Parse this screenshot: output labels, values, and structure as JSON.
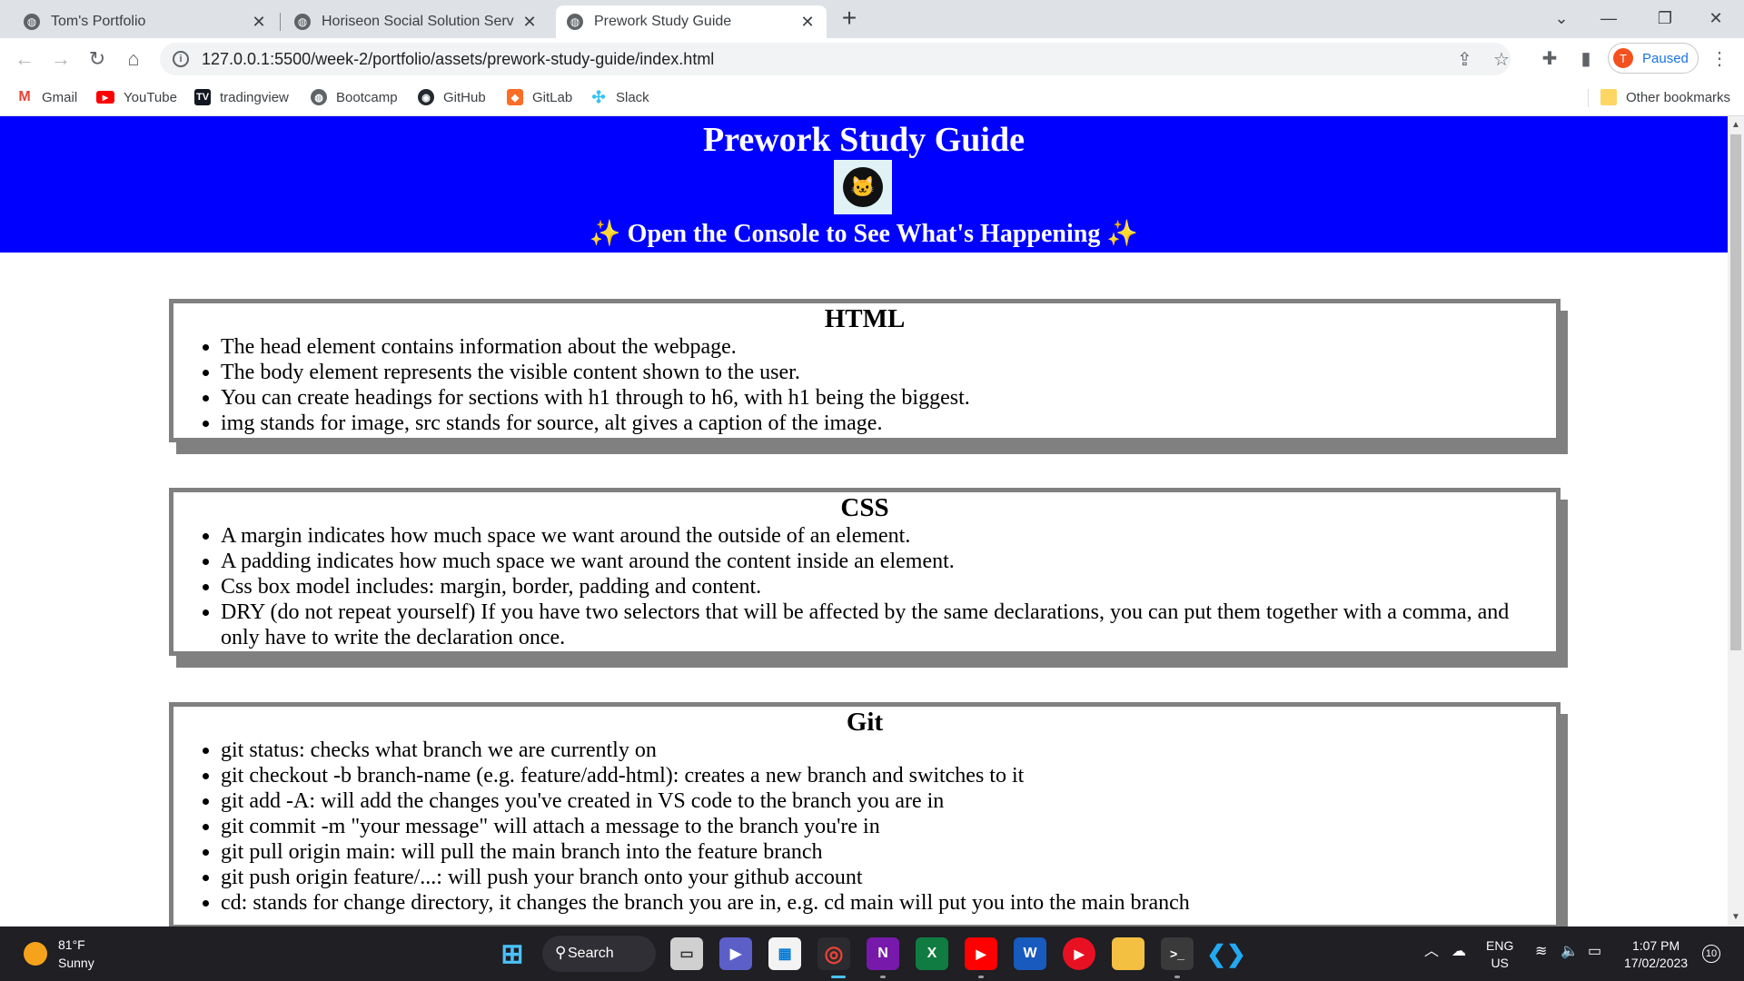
{
  "tabs": [
    {
      "title": "Tom's Portfolio"
    },
    {
      "title": "Horiseon Social Solution Services"
    },
    {
      "title": "Prework Study Guide"
    }
  ],
  "address_bar": {
    "url": "127.0.0.1:5500/week-2/portfolio/assets/prework-study-guide/index.html"
  },
  "profile": {
    "initial": "T",
    "status": "Paused"
  },
  "bookmarks": [
    "Gmail",
    "YouTube",
    "tradingview",
    "Bootcamp",
    "GitHub",
    "GitLab",
    "Slack"
  ],
  "other_bookmarks": "Other bookmarks",
  "page": {
    "title": "Prework Study Guide",
    "subtitle": "✨ Open the Console to See What's Happening ✨",
    "sections": [
      {
        "heading": "HTML",
        "items": [
          "The head element contains information about the webpage.",
          "The body element represents the visible content shown to the user.",
          "You can create headings for sections with h1 through to h6, with h1 being the biggest.",
          "img stands for image, src stands for source, alt gives a caption of the image."
        ]
      },
      {
        "heading": "CSS",
        "items": [
          "A margin indicates how much space we want around the outside of an element.",
          "A padding indicates how much space we want around the content inside an element.",
          "Css box model includes: margin, border, padding and content.",
          "DRY (do not repeat yourself) If you have two selectors that will be affected by the same declarations, you can put them together with a comma, and only have to write the declaration once."
        ]
      },
      {
        "heading": "Git",
        "items": [
          "git status: checks what branch we are currently on",
          "git checkout -b branch-name (e.g. feature/add-html): creates a new branch and switches to it",
          "git add -A: will add the changes you've created in VS code to the branch you are in",
          "git commit -m \"your message\" will attach a message to the branch you're in",
          "git pull origin main: will pull the main branch into the feature branch",
          "git push origin feature/...: will push your branch onto your github account",
          "cd: stands for change directory, it changes the branch you are in, e.g. cd main will put you into the main branch"
        ]
      }
    ]
  },
  "taskbar": {
    "weather_temp": "81°F",
    "weather_desc": "Sunny",
    "search_label": "Search",
    "lang": "ENG",
    "region": "US",
    "time": "1:07 PM",
    "date": "17/02/2023",
    "notification_count": "10"
  }
}
